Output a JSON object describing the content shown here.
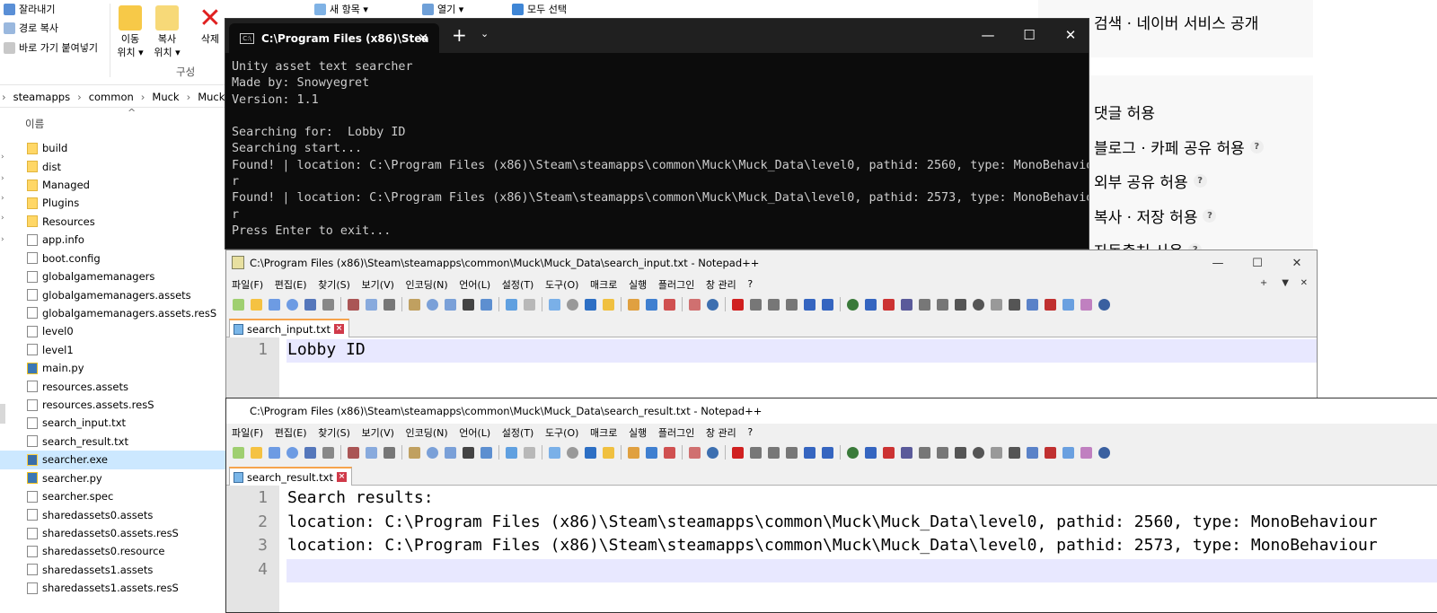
{
  "explorer": {
    "ribbon": {
      "cut": "잘라내기",
      "copy_path": "경로 복사",
      "paste_shortcut": "바로 가기 붙여넣기",
      "move_to": "이동\n위치 ▾",
      "copy_to": "복사\n위치 ▾",
      "delete": "삭제",
      "new_item": "새 항목 ▾",
      "open": "열기 ▾",
      "select_all": "모두 선택",
      "group_organize": "구성"
    },
    "breadcrumb": [
      "steamapps",
      "common",
      "Muck",
      "Muck"
    ],
    "column_name": "이름",
    "files": [
      {
        "name": "build",
        "type": "folder"
      },
      {
        "name": "dist",
        "type": "folder"
      },
      {
        "name": "Managed",
        "type": "folder"
      },
      {
        "name": "Plugins",
        "type": "folder"
      },
      {
        "name": "Resources",
        "type": "folder"
      },
      {
        "name": "app.info",
        "type": "file"
      },
      {
        "name": "boot.config",
        "type": "file"
      },
      {
        "name": "globalgamemanagers",
        "type": "file"
      },
      {
        "name": "globalgamemanagers.assets",
        "type": "file"
      },
      {
        "name": "globalgamemanagers.assets.resS",
        "type": "file"
      },
      {
        "name": "level0",
        "type": "file"
      },
      {
        "name": "level1",
        "type": "file"
      },
      {
        "name": "main.py",
        "type": "py"
      },
      {
        "name": "resources.assets",
        "type": "file"
      },
      {
        "name": "resources.assets.resS",
        "type": "file"
      },
      {
        "name": "search_input.txt",
        "type": "file"
      },
      {
        "name": "search_result.txt",
        "type": "file"
      },
      {
        "name": "searcher.exe",
        "type": "exe"
      },
      {
        "name": "searcher.py",
        "type": "py"
      },
      {
        "name": "searcher.spec",
        "type": "file"
      },
      {
        "name": "sharedassets0.assets",
        "type": "file"
      },
      {
        "name": "sharedassets0.assets.resS",
        "type": "file"
      },
      {
        "name": "sharedassets0.resource",
        "type": "file"
      },
      {
        "name": "sharedassets1.assets",
        "type": "file"
      },
      {
        "name": "sharedassets1.assets.resS",
        "type": "file"
      }
    ]
  },
  "blog_settings": {
    "search_public": "검색 · 네이버 서비스 공개",
    "options": [
      {
        "label": "댓글 허용",
        "help": false
      },
      {
        "label": "블로그 · 카페 공유 허용",
        "help": true
      },
      {
        "label": "외부 공유 허용",
        "help": true
      },
      {
        "label": "복사 · 저장 허용",
        "help": true
      },
      {
        "label": "자동출처 사용",
        "help": true
      }
    ]
  },
  "terminal": {
    "tab_title": "C:\\Program Files (x86)\\Stea",
    "output": "Unity asset text searcher\nMade by: Snowyegret\nVersion: 1.1\n\nSearching for:  Lobby ID\nSearching start...\nFound! | location: C:\\Program Files (x86)\\Steam\\steamapps\\common\\Muck\\Muck_Data\\level0, pathid: 2560, type: MonoBehaviou\nr\nFound! | location: C:\\Program Files (x86)\\Steam\\steamapps\\common\\Muck\\Muck_Data\\level0, pathid: 2573, type: MonoBehaviou\nr\nPress Enter to exit..."
  },
  "notepad_menu": [
    "파일(F)",
    "편집(E)",
    "찾기(S)",
    "보기(V)",
    "인코딩(N)",
    "언어(L)",
    "설정(T)",
    "도구(O)",
    "매크로",
    "실행",
    "플러그인",
    "창 관리",
    "?"
  ],
  "notepad_input": {
    "title": "C:\\Program Files (x86)\\Steam\\steamapps\\common\\Muck\\Muck_Data\\search_input.txt - Notepad++",
    "tab": "search_input.txt",
    "lines": [
      "Lobby ID"
    ]
  },
  "notepad_result": {
    "title": "C:\\Program Files (x86)\\Steam\\steamapps\\common\\Muck\\Muck_Data\\search_result.txt - Notepad++",
    "tab": "search_result.txt",
    "lines": [
      "Search results:",
      "location: C:\\Program Files (x86)\\Steam\\steamapps\\common\\Muck\\Muck_Data\\level0, pathid: 2560, type: MonoBehaviour",
      "location: C:\\Program Files (x86)\\Steam\\steamapps\\common\\Muck\\Muck_Data\\level0, pathid: 2573, type: MonoBehaviour",
      ""
    ]
  }
}
